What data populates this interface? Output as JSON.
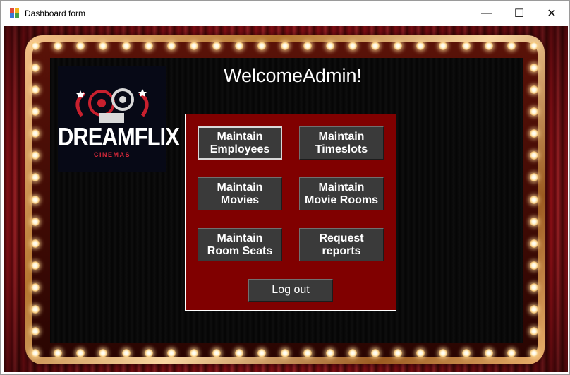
{
  "window": {
    "title": "Dashboard form",
    "controls": {
      "minimize": "—",
      "maximize": "☐",
      "close": "✕"
    }
  },
  "logo": {
    "main": "DREAMFLIX",
    "sub": "— CINEMAS —"
  },
  "welcome": "WelcomeAdmin!",
  "buttons": {
    "maintain_employees": "Maintain\nEmployees",
    "maintain_timeslots": "Maintain\nTimeslots",
    "maintain_movies": "Maintain\nMovies",
    "maintain_movie_rooms": "Maintain\nMovie Rooms",
    "maintain_room_seats": "Maintain\nRoom Seats",
    "request_reports": "Request\nreports",
    "log_out": "Log out"
  },
  "colors": {
    "panel": "#800000",
    "button": "#3a3a3a",
    "curtain": "#b3141c"
  }
}
